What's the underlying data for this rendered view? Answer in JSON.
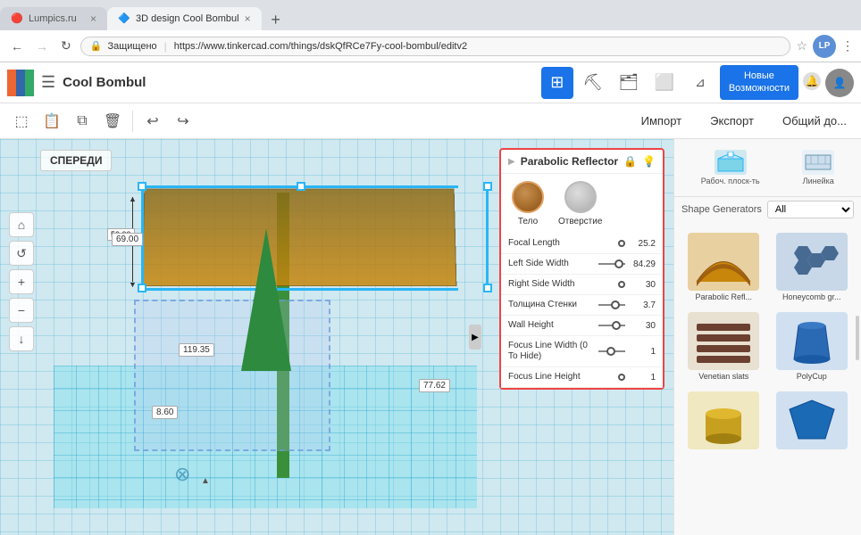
{
  "browser": {
    "tabs": [
      {
        "id": "tab1",
        "label": "Lumpics.ru",
        "favicon": "🔴",
        "active": false
      },
      {
        "id": "tab2",
        "label": "3D design Cool Bombul",
        "favicon": "🔷",
        "active": true
      }
    ],
    "url": "https://www.tinkercad.com/things/dskQfRCe7Fy-cool-bombul/editv2",
    "secure_label": "Защищено",
    "profile_initials": "LP"
  },
  "app": {
    "logo_letters": "TINKERCAD",
    "project_name": "Cool Bombul",
    "topbar_buttons": [
      "grid-icon",
      "pick-icon",
      "shapes-icon",
      "import-icon"
    ],
    "new_features_label": "Новые\nВозможности",
    "secondary_toolbar": {
      "tools": [
        "copy",
        "paste",
        "duplicate",
        "delete",
        "undo",
        "redo"
      ]
    },
    "import_btn": "Импорт",
    "export_btn": "Экспорт",
    "share_btn": "Общий до..."
  },
  "sidebar": {
    "workplane_label": "Рабоч. плоск-ть",
    "ruler_label": "Линейка",
    "shape_generators_label": "Shape Generators",
    "shape_generators_option": "All",
    "shapes": [
      {
        "id": "shape1",
        "label": "Parabolic Refl...",
        "color": "#c8860a"
      },
      {
        "id": "shape2",
        "label": "Honeycomb gr...",
        "color": "#3a5f8a"
      },
      {
        "id": "shape3",
        "label": "Venetian slats",
        "color": "#5a4030"
      },
      {
        "id": "shape4",
        "label": "PolyCup",
        "color": "#2a6ab5"
      },
      {
        "id": "shape5",
        "label": "",
        "color": "#c8a020"
      },
      {
        "id": "shape6",
        "label": "",
        "color": "#1a6ab5"
      }
    ]
  },
  "panel": {
    "title": "Parabolic Reflector",
    "shape_type_solid": "Тело",
    "shape_type_hole": "Отверстие",
    "rows": [
      {
        "id": "focal_length",
        "label": "Focal Length",
        "value": "25.2",
        "has_slider": false
      },
      {
        "id": "left_side_width",
        "label": "Left Side Width",
        "value": "84.29",
        "has_slider": true,
        "slider_pos": 0.6
      },
      {
        "id": "right_side_width",
        "label": "Right Side Width",
        "value": "30",
        "has_slider": false
      },
      {
        "id": "wall_thickness",
        "label": "Толщина Стенки",
        "value": "3.7",
        "has_slider": true,
        "slider_pos": 0.5
      },
      {
        "id": "wall_height",
        "label": "Wall Height",
        "value": "30",
        "has_slider": true,
        "slider_pos": 0.5
      },
      {
        "id": "focus_line_width",
        "label": "Focus Line Width (0 To Hide)",
        "value": "1",
        "has_slider": true,
        "slider_pos": 0.3
      },
      {
        "id": "focus_line_height",
        "label": "Focus Line Height",
        "value": "1",
        "has_slider": false
      }
    ]
  },
  "canvas": {
    "viewport_label": "СПЕРЕДИ",
    "measure_top": "50.00",
    "measure_mid": "69.00",
    "measure_bot1": "119.35",
    "measure_bot2": "77.62",
    "measure_bot3": "8.60"
  }
}
